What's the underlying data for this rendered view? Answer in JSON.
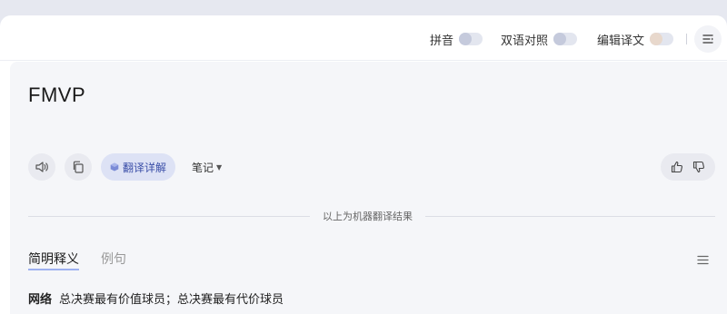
{
  "toolbar": {
    "pinyin_label": "拼音",
    "bilingual_label": "双语对照",
    "edit_label": "编辑译文"
  },
  "source": {
    "text": "FMVP"
  },
  "actions": {
    "detail_label": "翻译详解",
    "notes_label": "笔记"
  },
  "divider_label": "以上为机器翻译结果",
  "tabs": [
    {
      "label": "简明释义",
      "active": true
    },
    {
      "label": "例句",
      "active": false
    }
  ],
  "definition": {
    "tag": "网络",
    "text": "总决赛最有价值球员；总决赛最有代价球员"
  },
  "colors": {
    "accent": "#3a4ea8",
    "underline": "#9db0f0"
  },
  "icons": [
    "speaker-icon",
    "copy-icon",
    "cube-icon",
    "caret-down-icon",
    "thumbs-up-icon",
    "thumbs-down-icon",
    "menu-icon",
    "list-icon"
  ]
}
